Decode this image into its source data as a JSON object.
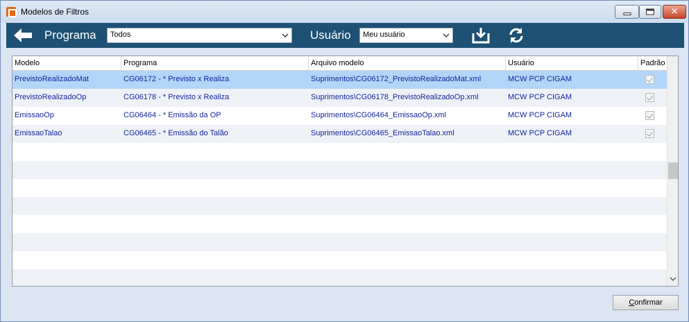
{
  "window": {
    "title": "Modelos de Filtros",
    "accent_color": "#1d5073"
  },
  "toolbar": {
    "programa_label": "Programa",
    "programa_value": "Todos",
    "usuario_label": "Usuário",
    "usuario_value": "Meu usuário",
    "icons": [
      "back-arrow-icon",
      "import-icon",
      "refresh-icon"
    ]
  },
  "grid": {
    "columns": [
      "Modelo",
      "Programa",
      "Arquivo modelo",
      "Usuário",
      "Padrão"
    ],
    "rows": [
      {
        "modelo": "PrevistoRealizadoMat",
        "programa": "CG06172 - * Previsto x Realiza",
        "arquivo": "Suprimentos\\CG06172_PrevistoRealizadoMat.xml",
        "usuario": "MCW   PCP CIGAM",
        "padrao": true
      },
      {
        "modelo": "PrevistoRealizadoOp",
        "programa": "CG06178 - * Previsto x Realiza",
        "arquivo": "Suprimentos\\CG06178_PrevistoRealizadoOp.xml",
        "usuario": "MCW   PCP CIGAM",
        "padrao": true
      },
      {
        "modelo": "EmissaoOp",
        "programa": "CG06464 - * Emissão da OP",
        "arquivo": "Suprimentos\\CG06464_EmissaoOp.xml",
        "usuario": "MCW   PCP CIGAM",
        "padrao": true
      },
      {
        "modelo": "EmissaoTalao",
        "programa": "CG06465 - * Emissão do Talão",
        "arquivo": "Suprimentos\\CG06465_EmissaoTalao.xml",
        "usuario": "MCW   PCP CIGAM",
        "padrao": true
      }
    ],
    "selected_row": 0
  },
  "footer": {
    "confirm_first": "C",
    "confirm_rest": "onfirmar"
  }
}
